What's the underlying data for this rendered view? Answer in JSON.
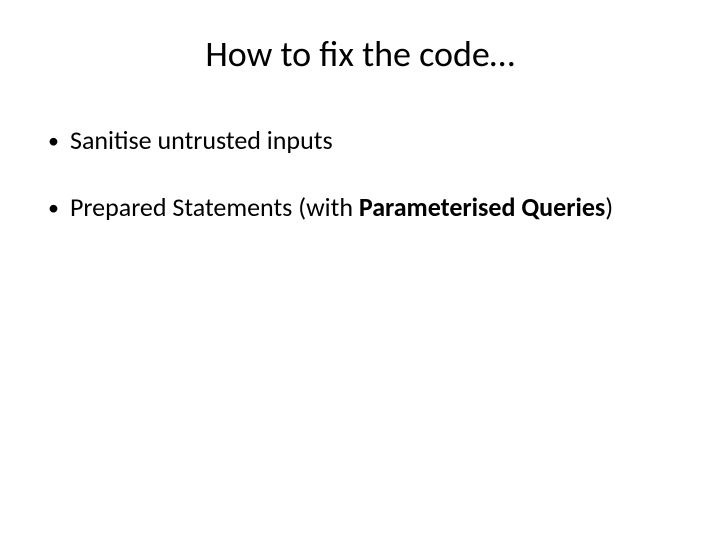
{
  "title": "How to fix the code…",
  "bullets": {
    "b1": {
      "marker": "•",
      "text": "Sanitise untrusted inputs"
    },
    "b2": {
      "marker": "•",
      "prefix": "Prepared Statements (with ",
      "bold": "Parameterised Queries",
      "suffix": ")"
    }
  }
}
